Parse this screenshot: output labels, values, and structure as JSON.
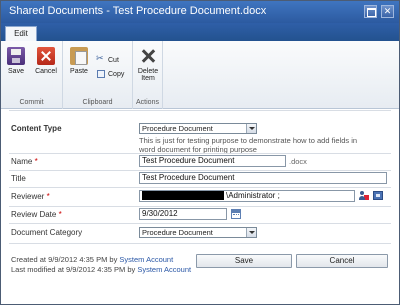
{
  "window": {
    "title": "Shared Documents - Test Procedure Document.docx"
  },
  "ribbon": {
    "tab": "Edit",
    "commit": {
      "label": "Commit",
      "save": "Save",
      "cancel": "Cancel"
    },
    "clipboard": {
      "label": "Clipboard",
      "paste": "Paste",
      "cut": "Cut",
      "copy": "Copy"
    },
    "actions": {
      "label": "Actions",
      "delete_line1": "Delete",
      "delete_line2": "Item"
    }
  },
  "form": {
    "content_type": {
      "label": "Content Type",
      "value": "Procedure Document",
      "description_line1": "This is just for testing purpose to demonstrate how to add fields in",
      "description_line2": "word document for printing purpose"
    },
    "name": {
      "label": "Name",
      "required": "*",
      "value": "Test Procedure Document",
      "extension": ".docx"
    },
    "title": {
      "label": "Title",
      "value": "Test Procedure Document"
    },
    "reviewer": {
      "label": "Reviewer",
      "required": "*",
      "value": "\\Administrator ;"
    },
    "review_date": {
      "label": "Review Date",
      "required": "*",
      "value": "9/30/2012"
    },
    "document_category": {
      "label": "Document Category",
      "value": "Procedure Document"
    }
  },
  "footer": {
    "created_prefix": "Created at 9/9/2012 4:35 PM  by ",
    "created_by": "System Account",
    "modified_prefix": "Last modified at 9/9/2012 4:35 PM  by ",
    "modified_by": "System Account",
    "save": "Save",
    "cancel": "Cancel"
  }
}
